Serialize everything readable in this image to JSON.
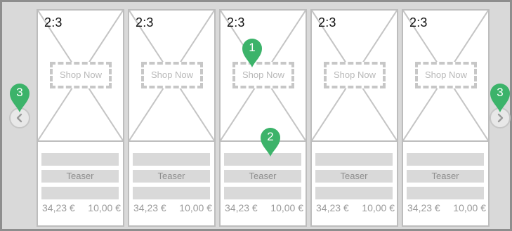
{
  "colors": {
    "frame_background": "#d9d9d9",
    "frame_border": "#8e8e8e",
    "card_border": "#bdbdbd",
    "placeholder_bar": "#d9d9d9",
    "marker_green": "#3cb36a"
  },
  "carousel": {
    "prev_icon": "chevron-left-icon",
    "next_icon": "chevron-right-icon",
    "cards": [
      {
        "ratio": "2:3",
        "cta": "Shop Now",
        "teaser": "Teaser",
        "price": "34,23 €",
        "sale_price": "10,00 €"
      },
      {
        "ratio": "2:3",
        "cta": "Shop Now",
        "teaser": "Teaser",
        "price": "34,23 €",
        "sale_price": "10,00 €"
      },
      {
        "ratio": "2:3",
        "cta": "Shop Now",
        "teaser": "Teaser",
        "price": "34,23 €",
        "sale_price": "10,00 €"
      },
      {
        "ratio": "2:3",
        "cta": "Shop Now",
        "teaser": "Teaser",
        "price": "34,23 €",
        "sale_price": "10,00 €"
      },
      {
        "ratio": "2:3",
        "cta": "Shop Now",
        "teaser": "Teaser",
        "price": "34,23 €",
        "sale_price": "10,00 €"
      }
    ]
  },
  "annotations": [
    {
      "label": "1"
    },
    {
      "label": "2"
    },
    {
      "label": "3"
    },
    {
      "label": "3"
    }
  ]
}
